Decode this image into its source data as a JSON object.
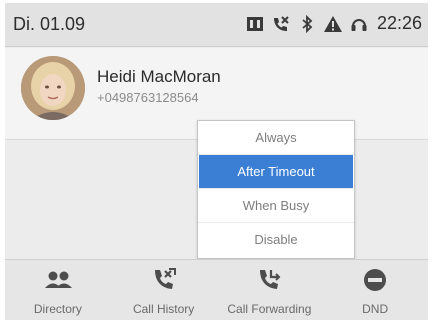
{
  "status_bar": {
    "date": "Di. 01.09",
    "time": "22:26",
    "icons": [
      "voicemail-icon",
      "missed-call-icon",
      "bluetooth-icon",
      "warning-icon",
      "headset-icon"
    ]
  },
  "contact": {
    "name": "Heidi MacMoran",
    "number": "+0498763128564"
  },
  "dropdown": {
    "items": [
      {
        "label": "Always",
        "selected": false
      },
      {
        "label": "After Timeout",
        "selected": true
      },
      {
        "label": "When Busy",
        "selected": false
      },
      {
        "label": "Disable",
        "selected": false
      }
    ]
  },
  "bottom_nav": {
    "items": [
      {
        "label": "Directory",
        "icon": "contacts-icon"
      },
      {
        "label": "Call History",
        "icon": "call-history-icon"
      },
      {
        "label": "Call Forwarding",
        "icon": "call-forwarding-icon"
      },
      {
        "label": "DND",
        "icon": "dnd-icon"
      }
    ]
  },
  "colors": {
    "accent": "#3a7fd4",
    "icon": "#4d4d4d"
  }
}
